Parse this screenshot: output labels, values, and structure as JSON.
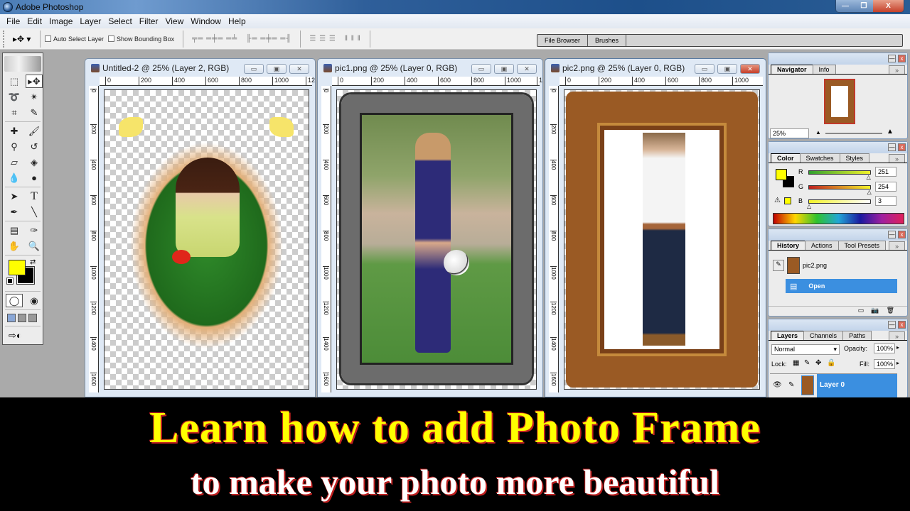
{
  "app": {
    "title": "Adobe Photoshop",
    "window_controls": {
      "minimize": "—",
      "restore": "❐",
      "close": "X"
    }
  },
  "menu": [
    "File",
    "Edit",
    "Image",
    "Layer",
    "Select",
    "Filter",
    "View",
    "Window",
    "Help"
  ],
  "options_bar": {
    "tool_icon": "move-tool",
    "auto_select_label": "Auto Select Layer",
    "show_bounding_label": "Show Bounding Box",
    "palette_well_tabs": [
      "File Browser",
      "Brushes"
    ]
  },
  "toolbox": {
    "tools": [
      "marquee",
      "move",
      "lasso",
      "magic-wand",
      "crop",
      "slice",
      "healing-brush",
      "brush",
      "clone-stamp",
      "history-brush",
      "eraser",
      "paint-bucket",
      "blur",
      "dodge",
      "path-selection",
      "type",
      "pen",
      "line",
      "notes",
      "eyedropper",
      "hand",
      "zoom"
    ],
    "foreground_color": "#FFFF00",
    "background_color": "#000000"
  },
  "documents": [
    {
      "title": "Untitled-2 @ 25% (Layer 2, RGB)",
      "active": false,
      "ruler_h": [
        "0",
        "200",
        "400",
        "600",
        "800",
        "1000",
        "12"
      ],
      "ruler_v": [
        "0",
        "200",
        "400",
        "600",
        "800",
        "1000",
        "1200",
        "1400",
        "1600"
      ]
    },
    {
      "title": "pic1.png @ 25% (Layer 0, RGB)",
      "active": false,
      "ruler_h": [
        "0",
        "200",
        "400",
        "600",
        "800",
        "1000",
        "1"
      ],
      "ruler_v": [
        "0",
        "200",
        "400",
        "600",
        "800",
        "1000",
        "1200",
        "1400",
        "1600"
      ]
    },
    {
      "title": "pic2.png @ 25% (Layer 0, RGB)",
      "active": true,
      "ruler_h": [
        "0",
        "200",
        "400",
        "600",
        "800",
        "1000"
      ],
      "ruler_v": [
        "0",
        "200",
        "400",
        "600",
        "800",
        "1000",
        "1200",
        "1400",
        "1600"
      ]
    }
  ],
  "navigator": {
    "tabs": [
      "Navigator",
      "Info"
    ],
    "zoom": "25%"
  },
  "color": {
    "tabs": [
      "Color",
      "Swatches",
      "Styles"
    ],
    "R": "251",
    "G": "254",
    "B": "3",
    "r_fraction": 0.984,
    "g_fraction": 0.996,
    "b_fraction": 0.012
  },
  "history": {
    "tabs": [
      "History",
      "Actions",
      "Tool Presets"
    ],
    "snapshot": "pic2.png",
    "items": [
      "Open"
    ]
  },
  "layers": {
    "tabs": [
      "Layers",
      "Channels",
      "Paths"
    ],
    "blend_mode": "Normal",
    "opacity_label": "Opacity:",
    "opacity": "100%",
    "lock_label": "Lock:",
    "fill_label": "Fill:",
    "fill": "100%",
    "layer_name": "Layer 0"
  },
  "caption": {
    "headline": "Learn how to add Photo Frame",
    "subline": "to make your photo more beautiful"
  }
}
